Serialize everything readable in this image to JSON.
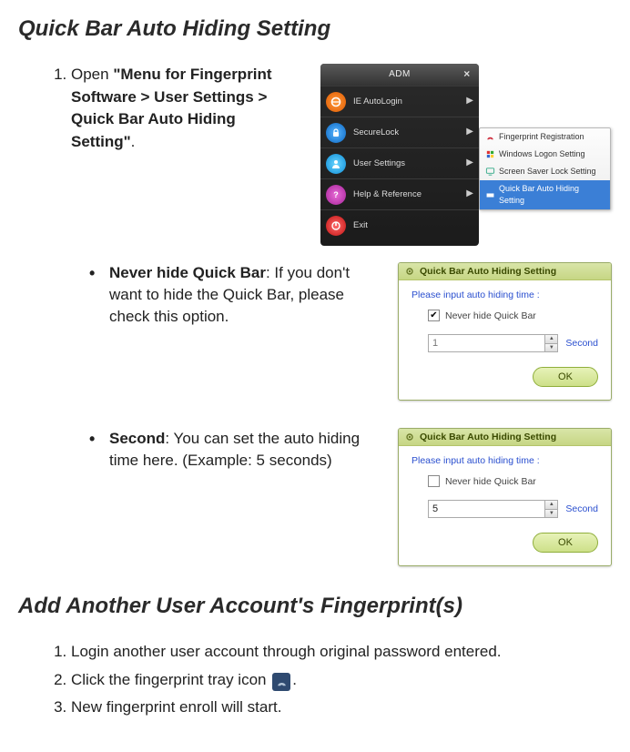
{
  "section1": {
    "title": "Quick Bar Auto Hiding Setting",
    "step1_prefix": "Open ",
    "step1_bold": "\"Menu for Fingerprint Software > User Settings > Quick Bar Auto Hiding Setting\"",
    "step1_suffix": "."
  },
  "adm": {
    "title": "ADM",
    "rows": [
      {
        "label": "IE AutoLogin"
      },
      {
        "label": "SecureLock"
      },
      {
        "label": "User Settings"
      },
      {
        "label": "Help & Reference"
      },
      {
        "label": "Exit"
      }
    ]
  },
  "submenu": {
    "items": [
      {
        "label": "Fingerprint Registration"
      },
      {
        "label": "Windows Logon Setting"
      },
      {
        "label": "Screen Saver Lock Setting"
      },
      {
        "label": "Quick Bar Auto Hiding Setting"
      }
    ]
  },
  "bullet_never": {
    "bold": "Never hide Quick Bar",
    "rest": ": If you don't want to hide the Quick Bar, please check this option."
  },
  "bullet_second": {
    "bold": "Second",
    "rest": ": You can set the auto hiding time here. (Example: 5 seconds)"
  },
  "dialog": {
    "title": "Quick Bar Auto Hiding Setting",
    "prompt": "Please input auto hiding time :",
    "check_label": "Never hide Quick Bar",
    "second_label": "Second",
    "ok": "OK",
    "value_disabled": "1",
    "value_enabled": "5"
  },
  "section2": {
    "title": "Add Another User Account's Fingerprint(s)",
    "step1": "Login another user account through original password entered.",
    "step2_prefix": "Click the fingerprint tray icon ",
    "step2_suffix": ".",
    "step3": "New fingerprint enroll will start."
  }
}
